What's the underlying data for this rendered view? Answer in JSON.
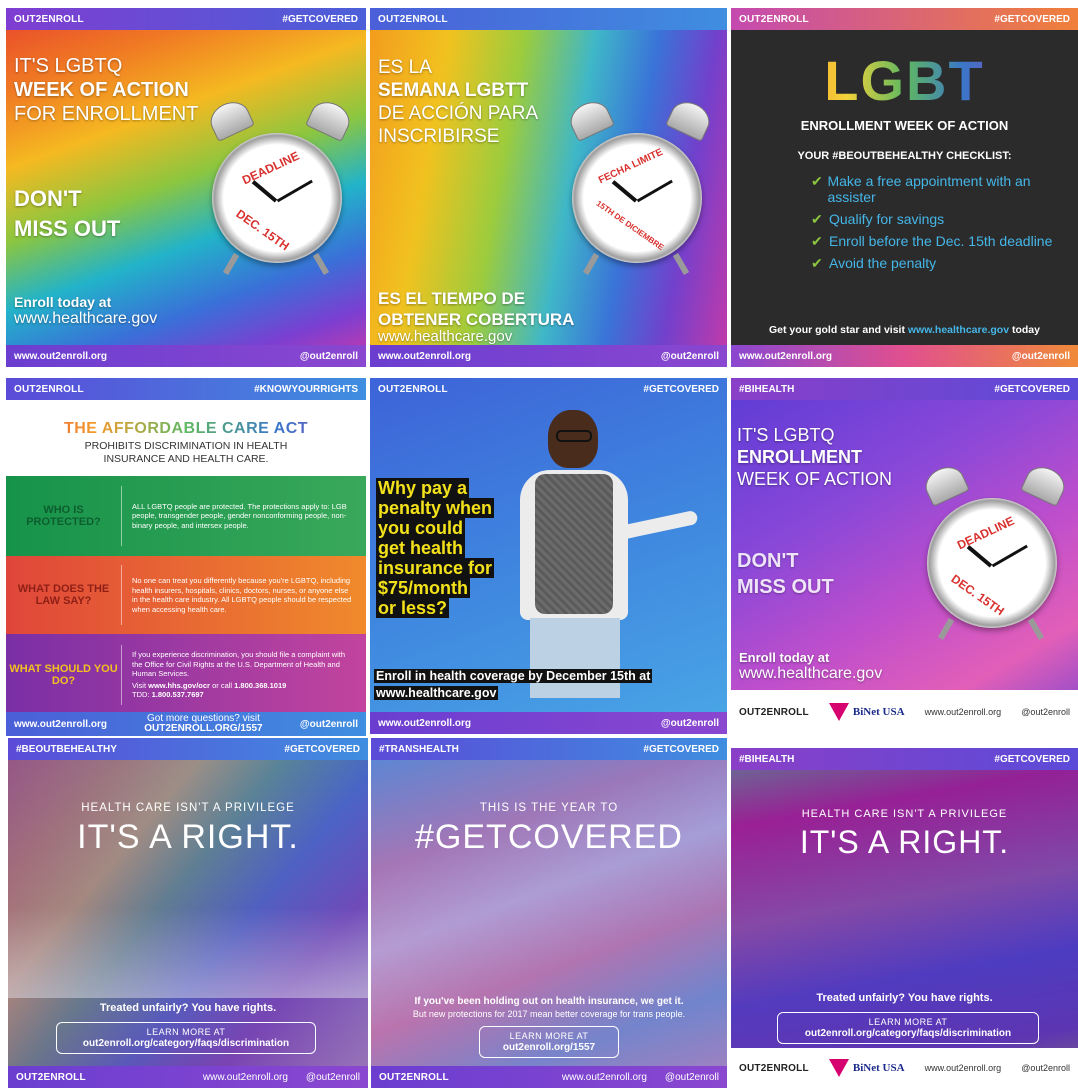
{
  "tiles": {
    "t1": {
      "logo": "OUT2ENROLL",
      "tag": "#GETCOVERED",
      "line1": "IT'S LGBTQ",
      "line2": "WEEK OF ACTION",
      "line3": "FOR ENROLLMENT",
      "cta1": "DON'T",
      "cta2": "MISS OUT",
      "clock_top": "DEADLINE",
      "clock_bottom": "DEC. 15TH",
      "enroll": "Enroll today at",
      "site": "www.healthcare.gov",
      "footer_left": "www.out2enroll.org",
      "footer_right": "@out2enroll"
    },
    "t2": {
      "logo": "OUT2ENROLL",
      "line1": "ES LA",
      "line2": "SEMANA LGBTT",
      "line3": "DE ACCIÓN PARA",
      "line4": "INSCRIBIRSE",
      "clock_top": "FECHA LIMITE",
      "clock_bottom": "15TH DE DICIEMBRE",
      "bottom1": "ES EL TIEMPO DE",
      "bottom2": "OBTENER COBERTURA",
      "site": "www.healthcare.gov",
      "footer_left": "www.out2enroll.org",
      "footer_right": "@out2enroll"
    },
    "t3": {
      "logo": "OUT2ENROLL",
      "tag": "#GETCOVERED",
      "big": "LGBT",
      "sub": "ENROLLMENT WEEK OF ACTION",
      "checklist_title": "YOUR #BEOUTBEHEALTHY CHECKLIST:",
      "items": [
        "Make a free appointment with an assister",
        "Qualify for savings",
        "Enroll before the Dec. 15th deadline",
        "Avoid the penalty"
      ],
      "gold": "Get your gold star and visit",
      "gold_site": "www.healthcare.gov",
      "gold_end": "today",
      "footer_left": "www.out2enroll.org",
      "footer_right": "@out2enroll"
    },
    "t4": {
      "logo": "OUT2ENROLL",
      "tag": "#KNOWYOURRIGHTS",
      "title": "THE AFFORDABLE CARE ACT",
      "subtitle": "PROHIBITS DISCRIMINATION IN HEALTH INSURANCE AND HEALTH CARE.",
      "rows": [
        {
          "q": "WHO IS PROTECTED?",
          "a": "ALL LGBTQ people are protected. The protections apply to: LGB people, transgender people, gender nonconforming people, non-binary people, and intersex people."
        },
        {
          "q": "WHAT DOES THE LAW SAY?",
          "a": "No one can treat you differently because you're LGBTQ, including health insurers, hospitals, clinics, doctors, nurses, or anyone else in the health care industry. All LGBTQ people should be respected when accessing health care."
        },
        {
          "q": "WHAT SHOULD YOU DO?",
          "a": "If you experience discrimination, you should file a complaint with the Office for Civil Rights at the U.S. Department of Health and Human Services."
        }
      ],
      "visit": "Visit",
      "visit_url": "www.hhs.gov/ocr",
      "call": "or call",
      "phone": "1.800.368.1019",
      "tdd_label": "TDD:",
      "tdd": "1.800.537.7697",
      "footer_left": "www.out2enroll.org",
      "footer_mid1": "Got more questions? visit",
      "footer_mid2": "OUT2ENROLL.ORG/1557",
      "footer_right": "@out2enroll"
    },
    "t5": {
      "logo": "OUT2ENROLL",
      "tag": "#GETCOVERED",
      "headline": [
        "Why pay a",
        "penalty when",
        "you could",
        "get health",
        "insurance for",
        "$75/month",
        "or less?"
      ],
      "enroll1": "Enroll in health coverage by December 15th at",
      "enroll2": "www.healthcare.gov",
      "footer_left": "www.out2enroll.org",
      "footer_right": "@out2enroll"
    },
    "t6": {
      "tag_left": "#BIHEALTH",
      "tag": "#GETCOVERED",
      "line1": "IT'S LGBTQ",
      "line2": "ENROLLMENT",
      "line3": "WEEK OF ACTION",
      "cta1": "DON'T",
      "cta2": "MISS OUT",
      "clock_top": "DEADLINE",
      "clock_bottom": "DEC. 15TH",
      "enroll": "Enroll today at",
      "site": "www.healthcare.gov",
      "logo": "OUT2ENROLL",
      "partner": "BiNet USA",
      "footer_mid": "www.out2enroll.org",
      "footer_right": "@out2enroll"
    },
    "t7": {
      "tag_left": "#BEOUTBEHEALTHY",
      "tag": "#GETCOVERED",
      "small": "HEALTH CARE ISN'T A PRIVILEGE",
      "big": "IT'S A RIGHT.",
      "treated": "Treated unfairly? You have rights.",
      "learn1": "LEARN MORE AT",
      "learn2": "out2enroll.org/category/faqs/discrimination",
      "logo": "OUT2ENROLL",
      "footer_mid": "www.out2enroll.org",
      "footer_right": "@out2enroll"
    },
    "t8": {
      "tag_left": "#TRANSHEALTH",
      "tag": "#GETCOVERED",
      "small": "THIS IS THE YEAR TO",
      "big": "#GETCOVERED",
      "line1": "If you've been holding out on health insurance, we get it.",
      "line2": "But new protections for 2017 mean better coverage for trans people.",
      "learn1": "LEARN MORE AT",
      "learn2": "out2enroll.org/1557",
      "logo": "OUT2ENROLL",
      "footer_mid": "www.out2enroll.org",
      "footer_right": "@out2enroll"
    },
    "t9": {
      "tag_left": "#BIHEALTH",
      "tag": "#GETCOVERED",
      "small": "HEALTH CARE ISN'T A PRIVILEGE",
      "big": "IT'S A RIGHT.",
      "treated": "Treated unfairly? You have rights.",
      "learn1": "LEARN MORE AT",
      "learn2": "out2enroll.org/category/faqs/discrimination",
      "logo": "OUT2ENROLL",
      "partner": "BiNet USA",
      "footer_mid": "www.out2enroll.org",
      "footer_right": "@out2enroll"
    }
  }
}
